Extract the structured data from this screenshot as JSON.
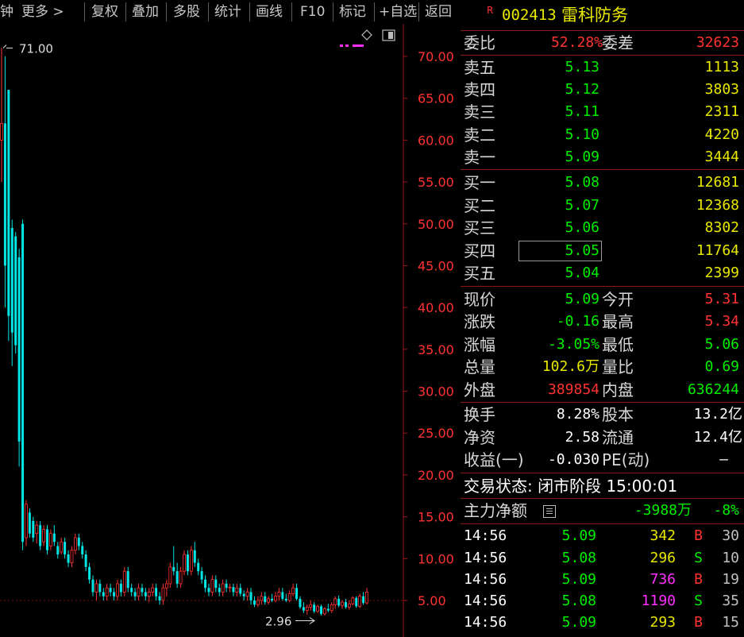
{
  "toolbar": {
    "items": [
      "钟",
      "更多 >",
      "复权",
      "叠加",
      "多股",
      "统计",
      "画线",
      "F10",
      "标记",
      "+自选",
      "返回"
    ]
  },
  "chart": {
    "y_tick_labels": [
      "70.00",
      "65.00",
      "60.00",
      "55.00",
      "50.00",
      "45.00",
      "40.00",
      "35.00",
      "30.00",
      "25.00",
      "20.00",
      "15.00",
      "10.00",
      "5.00"
    ],
    "high_marker": "71.00",
    "low_marker": "2.96",
    "colors": {
      "up": "#ff3232",
      "down": "#00e5e5",
      "axis": "#a01818",
      "magenta": "#ff30ff"
    }
  },
  "chart_data": {
    "type": "candlestick",
    "ylim": [
      2.0,
      73.0
    ],
    "y_ticks": [
      70,
      65,
      60,
      55,
      50,
      45,
      40,
      35,
      30,
      25,
      20,
      15,
      10,
      5
    ],
    "annotations": [
      {
        "text": "71.00",
        "value": 71.0
      },
      {
        "text": "2.96",
        "value": 2.96
      }
    ],
    "candles": [
      {
        "o": 60.0,
        "h": 71.0,
        "l": 55.0,
        "c": 62.0
      },
      {
        "o": 62.0,
        "h": 70.0,
        "l": 40.0,
        "c": 45.0
      },
      {
        "o": 66.0,
        "h": 66.0,
        "l": 36.0,
        "c": 39.0
      },
      {
        "o": 49.5,
        "h": 50.5,
        "l": 33.0,
        "c": 37.0
      },
      {
        "o": 48.5,
        "h": 49.0,
        "l": 34.5,
        "c": 35.5
      },
      {
        "o": 46.0,
        "h": 47.0,
        "l": 21.0,
        "c": 24.0
      },
      {
        "o": 50.0,
        "h": 50.5,
        "l": 11.0,
        "c": 12.0
      },
      {
        "o": 12.5,
        "h": 17.0,
        "l": 11.5,
        "c": 16.5
      },
      {
        "o": 15.5,
        "h": 16.0,
        "l": 12.5,
        "c": 13.0
      },
      {
        "o": 14.5,
        "h": 15.0,
        "l": 12.0,
        "c": 12.5
      },
      {
        "o": 13.0,
        "h": 14.5,
        "l": 11.8,
        "c": 14.0
      },
      {
        "o": 14.0,
        "h": 14.5,
        "l": 11.0,
        "c": 11.5
      },
      {
        "o": 12.0,
        "h": 14.0,
        "l": 11.5,
        "c": 13.5
      },
      {
        "o": 13.5,
        "h": 14.0,
        "l": 10.5,
        "c": 11.0
      },
      {
        "o": 11.5,
        "h": 13.5,
        "l": 11.0,
        "c": 13.0
      },
      {
        "o": 13.0,
        "h": 14.0,
        "l": 11.5,
        "c": 12.0
      },
      {
        "o": 11.5,
        "h": 12.0,
        "l": 10.0,
        "c": 10.5
      },
      {
        "o": 10.8,
        "h": 12.5,
        "l": 10.5,
        "c": 12.0
      },
      {
        "o": 12.0,
        "h": 12.5,
        "l": 10.0,
        "c": 10.5
      },
      {
        "o": 10.5,
        "h": 11.0,
        "l": 9.0,
        "c": 9.5
      },
      {
        "o": 9.5,
        "h": 11.5,
        "l": 9.0,
        "c": 11.0
      },
      {
        "o": 11.0,
        "h": 13.0,
        "l": 10.5,
        "c": 12.5
      },
      {
        "o": 12.5,
        "h": 13.0,
        "l": 11.0,
        "c": 11.5
      },
      {
        "o": 11.5,
        "h": 12.0,
        "l": 10.0,
        "c": 10.5
      },
      {
        "o": 10.5,
        "h": 11.0,
        "l": 8.5,
        "c": 9.0
      },
      {
        "o": 9.0,
        "h": 9.5,
        "l": 7.0,
        "c": 7.5
      },
      {
        "o": 7.5,
        "h": 8.0,
        "l": 5.5,
        "c": 6.0
      },
      {
        "o": 6.0,
        "h": 7.5,
        "l": 5.0,
        "c": 7.0
      },
      {
        "o": 7.0,
        "h": 7.5,
        "l": 5.5,
        "c": 6.0
      },
      {
        "o": 6.0,
        "h": 6.5,
        "l": 5.0,
        "c": 5.5
      },
      {
        "o": 5.5,
        "h": 7.0,
        "l": 5.0,
        "c": 6.5
      },
      {
        "o": 6.5,
        "h": 7.0,
        "l": 5.5,
        "c": 6.0
      },
      {
        "o": 6.0,
        "h": 6.5,
        "l": 5.0,
        "c": 5.5
      },
      {
        "o": 5.5,
        "h": 7.5,
        "l": 5.0,
        "c": 7.0
      },
      {
        "o": 7.0,
        "h": 7.5,
        "l": 5.5,
        "c": 6.0
      },
      {
        "o": 6.0,
        "h": 9.0,
        "l": 5.5,
        "c": 8.5
      },
      {
        "o": 8.5,
        "h": 9.0,
        "l": 6.0,
        "c": 6.5
      },
      {
        "o": 6.5,
        "h": 7.0,
        "l": 5.5,
        "c": 6.0
      },
      {
        "o": 6.0,
        "h": 6.5,
        "l": 5.0,
        "c": 5.5
      },
      {
        "o": 5.5,
        "h": 7.0,
        "l": 5.0,
        "c": 6.5
      },
      {
        "o": 6.5,
        "h": 7.0,
        "l": 5.5,
        "c": 6.0
      },
      {
        "o": 6.0,
        "h": 6.5,
        "l": 5.0,
        "c": 5.5
      },
      {
        "o": 5.5,
        "h": 6.5,
        "l": 4.8,
        "c": 6.0
      },
      {
        "o": 6.0,
        "h": 7.0,
        "l": 5.5,
        "c": 6.5
      },
      {
        "o": 6.5,
        "h": 7.0,
        "l": 5.0,
        "c": 5.5
      },
      {
        "o": 5.5,
        "h": 6.0,
        "l": 4.5,
        "c": 5.0
      },
      {
        "o": 5.0,
        "h": 7.0,
        "l": 4.5,
        "c": 6.5
      },
      {
        "o": 6.5,
        "h": 7.5,
        "l": 5.5,
        "c": 7.0
      },
      {
        "o": 7.0,
        "h": 9.5,
        "l": 6.5,
        "c": 9.0
      },
      {
        "o": 9.0,
        "h": 11.5,
        "l": 8.0,
        "c": 8.5
      },
      {
        "o": 8.5,
        "h": 9.5,
        "l": 6.5,
        "c": 7.0
      },
      {
        "o": 7.0,
        "h": 9.0,
        "l": 6.5,
        "c": 8.5
      },
      {
        "o": 8.5,
        "h": 11.0,
        "l": 8.0,
        "c": 10.5
      },
      {
        "o": 10.5,
        "h": 11.0,
        "l": 8.0,
        "c": 8.5
      },
      {
        "o": 8.5,
        "h": 11.5,
        "l": 8.0,
        "c": 11.0
      },
      {
        "o": 11.0,
        "h": 12.0,
        "l": 9.0,
        "c": 9.5
      },
      {
        "o": 9.5,
        "h": 10.0,
        "l": 8.0,
        "c": 8.5
      },
      {
        "o": 8.5,
        "h": 9.0,
        "l": 7.0,
        "c": 7.5
      },
      {
        "o": 7.5,
        "h": 8.0,
        "l": 6.0,
        "c": 6.5
      },
      {
        "o": 6.5,
        "h": 7.0,
        "l": 5.5,
        "c": 6.0
      },
      {
        "o": 6.0,
        "h": 8.0,
        "l": 5.5,
        "c": 7.5
      },
      {
        "o": 7.5,
        "h": 8.0,
        "l": 6.0,
        "c": 6.5
      },
      {
        "o": 6.5,
        "h": 7.0,
        "l": 5.5,
        "c": 6.0
      },
      {
        "o": 6.0,
        "h": 7.5,
        "l": 5.5,
        "c": 7.0
      },
      {
        "o": 7.0,
        "h": 7.5,
        "l": 6.0,
        "c": 6.5
      },
      {
        "o": 6.5,
        "h": 7.0,
        "l": 6.0,
        "c": 6.6
      },
      {
        "o": 6.6,
        "h": 7.0,
        "l": 5.5,
        "c": 6.0
      },
      {
        "o": 6.0,
        "h": 7.0,
        "l": 5.5,
        "c": 6.5
      },
      {
        "o": 6.5,
        "h": 7.0,
        "l": 5.5,
        "c": 5.8
      },
      {
        "o": 5.8,
        "h": 6.2,
        "l": 5.0,
        "c": 5.5
      },
      {
        "o": 5.5,
        "h": 6.5,
        "l": 5.0,
        "c": 6.0
      },
      {
        "o": 6.0,
        "h": 6.5,
        "l": 4.5,
        "c": 5.0
      },
      {
        "o": 5.0,
        "h": 5.5,
        "l": 4.2,
        "c": 4.5
      },
      {
        "o": 4.5,
        "h": 5.5,
        "l": 4.2,
        "c": 5.0
      },
      {
        "o": 5.0,
        "h": 6.0,
        "l": 4.5,
        "c": 5.5
      },
      {
        "o": 5.5,
        "h": 6.0,
        "l": 4.5,
        "c": 4.8
      },
      {
        "o": 4.8,
        "h": 5.5,
        "l": 4.5,
        "c": 5.2
      },
      {
        "o": 5.2,
        "h": 5.8,
        "l": 4.8,
        "c": 5.0
      },
      {
        "o": 5.0,
        "h": 6.0,
        "l": 4.8,
        "c": 5.5
      },
      {
        "o": 5.5,
        "h": 6.5,
        "l": 5.0,
        "c": 6.0
      },
      {
        "o": 6.0,
        "h": 6.5,
        "l": 5.0,
        "c": 5.2
      },
      {
        "o": 5.2,
        "h": 5.8,
        "l": 4.8,
        "c": 5.0
      },
      {
        "o": 5.0,
        "h": 6.2,
        "l": 4.8,
        "c": 5.8
      },
      {
        "o": 5.8,
        "h": 7.0,
        "l": 5.5,
        "c": 6.5
      },
      {
        "o": 6.5,
        "h": 7.0,
        "l": 5.0,
        "c": 5.2
      },
      {
        "o": 5.2,
        "h": 5.5,
        "l": 4.0,
        "c": 4.2
      },
      {
        "o": 4.2,
        "h": 4.8,
        "l": 3.5,
        "c": 3.8
      },
      {
        "o": 3.8,
        "h": 4.5,
        "l": 3.3,
        "c": 4.2
      },
      {
        "o": 4.2,
        "h": 5.0,
        "l": 3.8,
        "c": 4.5
      },
      {
        "o": 4.5,
        "h": 4.8,
        "l": 3.5,
        "c": 3.7
      },
      {
        "o": 3.7,
        "h": 4.5,
        "l": 3.5,
        "c": 4.3
      },
      {
        "o": 4.3,
        "h": 4.5,
        "l": 3.2,
        "c": 3.4
      },
      {
        "o": 3.4,
        "h": 4.2,
        "l": 3.2,
        "c": 4.0
      },
      {
        "o": 4.0,
        "h": 4.6,
        "l": 3.6,
        "c": 3.8
      },
      {
        "o": 3.8,
        "h": 4.8,
        "l": 3.5,
        "c": 4.5
      },
      {
        "o": 4.5,
        "h": 5.5,
        "l": 4.0,
        "c": 5.2
      },
      {
        "o": 5.2,
        "h": 5.6,
        "l": 4.2,
        "c": 4.4
      },
      {
        "o": 4.4,
        "h": 5.0,
        "l": 4.0,
        "c": 4.8
      },
      {
        "o": 4.8,
        "h": 5.2,
        "l": 4.0,
        "c": 4.2
      },
      {
        "o": 4.2,
        "h": 5.0,
        "l": 3.9,
        "c": 4.6
      },
      {
        "o": 4.6,
        "h": 5.5,
        "l": 4.4,
        "c": 5.3
      },
      {
        "o": 5.3,
        "h": 5.5,
        "l": 4.1,
        "c": 4.3
      },
      {
        "o": 4.3,
        "h": 5.8,
        "l": 4.1,
        "c": 5.5
      },
      {
        "o": 5.5,
        "h": 6.0,
        "l": 4.5,
        "c": 4.7
      },
      {
        "o": 4.7,
        "h": 6.5,
        "l": 4.5,
        "c": 6.0
      }
    ]
  },
  "stock": {
    "badge": "R",
    "code": "002413",
    "name": "雷科防务"
  },
  "order_ratio": {
    "label1": "委比",
    "value1": "52.28%",
    "label2": "委差",
    "value2": "32623"
  },
  "sell": [
    {
      "label": "卖五",
      "price": "5.13",
      "volume": "1113"
    },
    {
      "label": "卖四",
      "price": "5.12",
      "volume": "3803"
    },
    {
      "label": "卖三",
      "price": "5.11",
      "volume": "2311"
    },
    {
      "label": "卖二",
      "price": "5.10",
      "volume": "4220"
    },
    {
      "label": "卖一",
      "price": "5.09",
      "volume": "3444"
    }
  ],
  "buy": [
    {
      "label": "买一",
      "price": "5.08",
      "volume": "12681"
    },
    {
      "label": "买二",
      "price": "5.07",
      "volume": "12368"
    },
    {
      "label": "买三",
      "price": "5.06",
      "volume": "8302"
    },
    {
      "label": "买四",
      "price": "5.05",
      "volume": "11764"
    },
    {
      "label": "买五",
      "price": "5.04",
      "volume": "2399"
    }
  ],
  "quote": [
    {
      "l1": "现价",
      "v1": "5.09",
      "l2": "今开",
      "v2": "5.31"
    },
    {
      "l1": "涨跌",
      "v1": "-0.16",
      "l2": "最高",
      "v2": "5.34"
    },
    {
      "l1": "涨幅",
      "v1": "-3.05%",
      "l2": "最低",
      "v2": "5.06"
    },
    {
      "l1": "总量",
      "v1": "102.6万",
      "l2": "量比",
      "v2": "0.69"
    },
    {
      "l1": "外盘",
      "v1": "389854",
      "l2": "内盘",
      "v2": "636244"
    }
  ],
  "fundamentals": [
    {
      "l1": "换手",
      "v1": "8.28%",
      "l2": "股本",
      "v2": "13.2亿"
    },
    {
      "l1": "净资",
      "v1": "2.58",
      "l2": "流通",
      "v2": "12.4亿"
    },
    {
      "l1": "收益(一)",
      "v1": "-0.030",
      "l2": "PE(动)",
      "v2": "–"
    }
  ],
  "status": {
    "text": "交易状态: 闭市阶段 15:00:01"
  },
  "main_flow": {
    "label": "主力净额",
    "value": "-3988万",
    "pct": "-8%"
  },
  "ticks": [
    {
      "time": "14:56",
      "price": "5.09",
      "vol": "342",
      "side": "B",
      "count": "30"
    },
    {
      "time": "14:56",
      "price": "5.08",
      "vol": "296",
      "side": "S",
      "count": "10"
    },
    {
      "time": "14:56",
      "price": "5.09",
      "vol": "736",
      "side": "B",
      "count": "19"
    },
    {
      "time": "14:56",
      "price": "5.08",
      "vol": "1190",
      "side": "S",
      "count": "35"
    },
    {
      "time": "14:56",
      "price": "5.09",
      "vol": "293",
      "side": "B",
      "count": "15"
    }
  ]
}
